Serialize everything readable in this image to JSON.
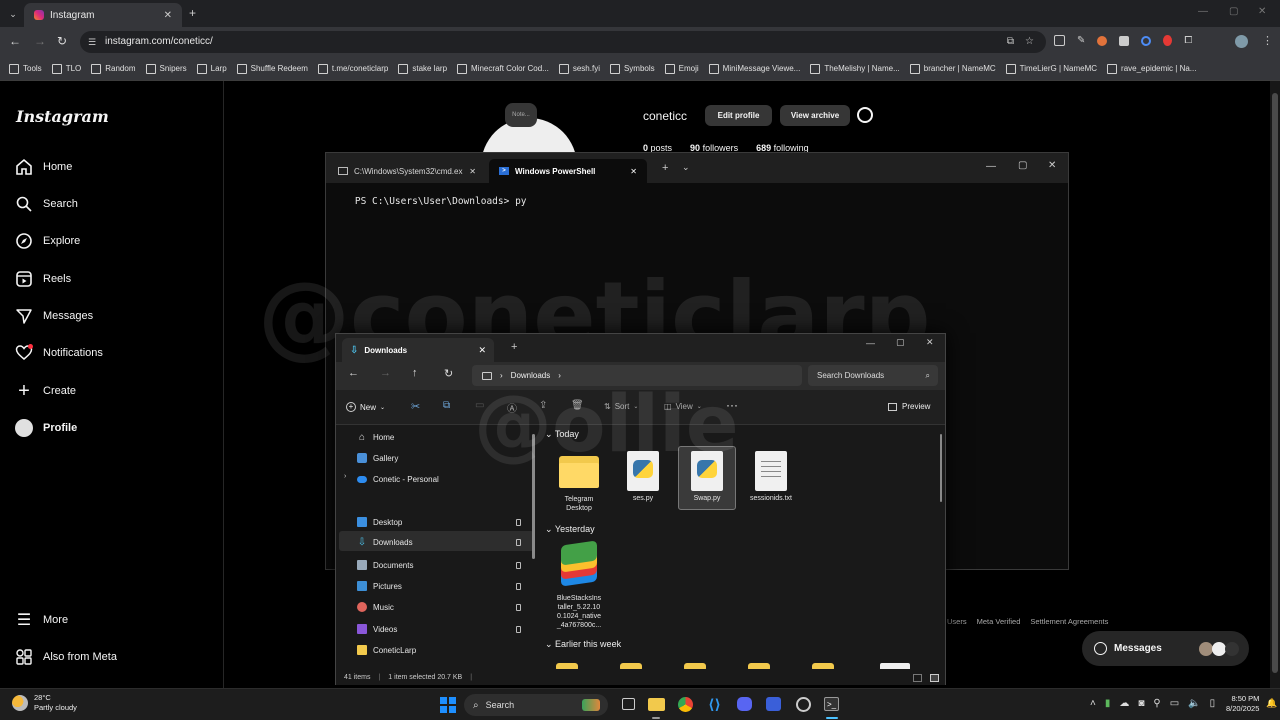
{
  "browser": {
    "tab_title": "Instagram",
    "url": "instagram.com/coneticc/",
    "bookmarks": [
      "Tools",
      "TLO",
      "Random",
      "Snipers",
      "Larp",
      "Shuffle Redeem",
      "t.me/coneticlarp",
      "stake larp",
      "Minecraft Color Cod...",
      "sesh.fyi",
      "Symbols",
      "Emoji",
      "MiniMessage Viewe...",
      "TheMelishy | Name...",
      "brancher | NameMC",
      "TimeLierG | NameMC",
      "rave_epidemic | Na..."
    ]
  },
  "instagram": {
    "logo": "Instagram",
    "nav": [
      "Home",
      "Search",
      "Explore",
      "Reels",
      "Messages",
      "Notifications",
      "Create",
      "Profile"
    ],
    "more": "More",
    "also_from_meta": "Also from Meta",
    "note_bubble": "Note...",
    "username": "coneticc",
    "edit_profile": "Edit profile",
    "view_archive": "View archive",
    "posts_count": "0",
    "posts_label": "posts",
    "followers_count": "90",
    "followers_label": "followers",
    "following_count": "689",
    "following_label": "following",
    "footer_links": [
      "Users",
      "Meta Verified",
      "Settlement Agreements"
    ],
    "messages_button": "Messages"
  },
  "terminal": {
    "tab1": "C:\\Windows\\System32\\cmd.ex",
    "tab2": "Windows PowerShell",
    "prompt": "PS C:\\Users\\User\\Downloads>",
    "command": "py"
  },
  "watermark": {
    "line1": "@coneticlarp",
    "line2": "@ollie"
  },
  "explorer": {
    "tab_title": "Downloads",
    "breadcrumb": "Downloads",
    "search_placeholder": "Search Downloads",
    "toolbar": {
      "new": "New",
      "sort": "Sort",
      "view": "View",
      "preview": "Preview"
    },
    "sidebar": [
      {
        "label": "Home",
        "icon": "home-icon"
      },
      {
        "label": "Gallery",
        "icon": "gallery-icon"
      },
      {
        "label": "Conetic - Personal",
        "icon": "cloud-icon"
      },
      {
        "label": "Desktop",
        "icon": "desktop-icon"
      },
      {
        "label": "Downloads",
        "icon": "download-icon"
      },
      {
        "label": "Documents",
        "icon": "documents-icon"
      },
      {
        "label": "Pictures",
        "icon": "pictures-icon"
      },
      {
        "label": "Music",
        "icon": "music-icon"
      },
      {
        "label": "Videos",
        "icon": "videos-icon"
      },
      {
        "label": "ConeticLarp",
        "icon": "folder-icon"
      }
    ],
    "groups": {
      "today": "Today",
      "yesterday": "Yesterday",
      "earlier": "Earlier this week"
    },
    "files_today": [
      "Telegram Desktop",
      "ses.py",
      "Swap.py",
      "sessionids.txt"
    ],
    "file_yesterday": "BlueStacksInstaller_5.22.100.1024_native_4a767800c...",
    "file_yesterday_lines": [
      "BlueStacksIns",
      "taller_5.22.10",
      "0.1024_native",
      "_4a767800c..."
    ],
    "status_items": "41 items",
    "status_selected": "1 item selected  20.7 KB"
  },
  "taskbar": {
    "temp": "28°C",
    "weather": "Partly cloudy",
    "search": "Search",
    "time": "8:50 PM",
    "date": "8/20/2025"
  }
}
